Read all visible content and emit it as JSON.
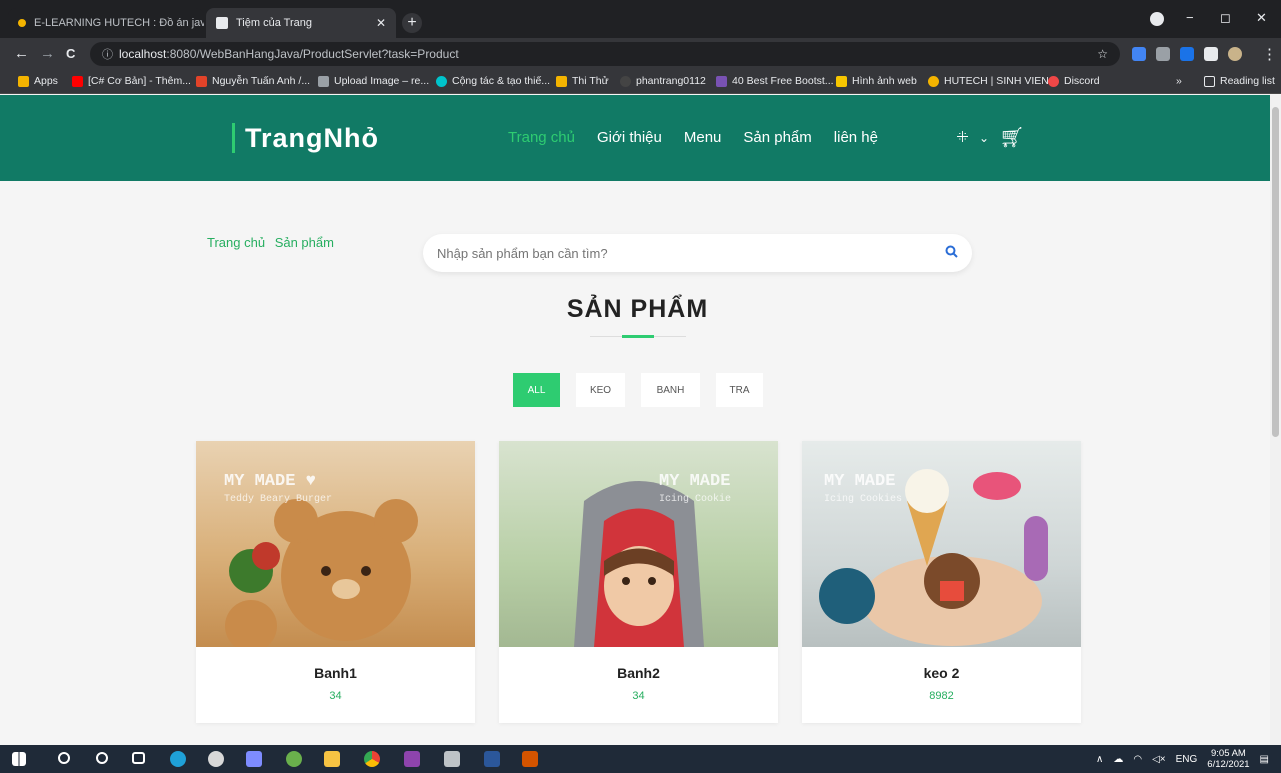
{
  "browser": {
    "tabs": [
      {
        "title": "E-LEARNING HUTECH : Đồ án jav",
        "active": false
      },
      {
        "title": "Tiệm của Trang",
        "active": true
      }
    ],
    "url_host": "localhost",
    "url_rest": ":8080/WebBanHangJava/ProductServlet?task=Product",
    "bookmarks": [
      {
        "label": "Apps",
        "color": "#f4b400"
      },
      {
        "label": "[C# Cơ Bản] - Thêm...",
        "color": "#ff0000"
      },
      {
        "label": "Nguyễn Tuấn Anh /...",
        "color": "#e24329"
      },
      {
        "label": "Upload Image – re...",
        "color": "#9aa0a6"
      },
      {
        "label": "Cộng tác & tạo thiế...",
        "color": "#00c4cc"
      },
      {
        "label": "Thi Thử",
        "color": "#f4b400"
      },
      {
        "label": "phantrang0112",
        "color": "#444"
      },
      {
        "label": "40 Best Free Bootst...",
        "color": "#7952b3"
      },
      {
        "label": "Hình ảnh web",
        "color": "#f7c600"
      },
      {
        "label": "HUTECH | SINH VIEN",
        "color": "#f4b400"
      },
      {
        "label": "Discord",
        "color": "#f04747"
      }
    ],
    "reading_list": "Reading list",
    "more_bookmarks": "»"
  },
  "site": {
    "logo": "TrangNhỏ",
    "menu": [
      "Trang chủ",
      "Giới thiệu",
      "Menu",
      "Sản phẩm",
      "liên hệ"
    ],
    "current_menu": "Trang chủ"
  },
  "breadcrumb": [
    "Trang chủ",
    "Sản phẩm"
  ],
  "search": {
    "placeholder": "Nhập sản phẩm bạn cần tìm?"
  },
  "section_title": "SẢN PHẨM",
  "filters": [
    {
      "label": "ALL",
      "active": true
    },
    {
      "label": "KEO",
      "active": false
    },
    {
      "label": "BANH",
      "active": false
    },
    {
      "label": "TRA",
      "active": false
    }
  ],
  "products": [
    {
      "name": "Banh1",
      "price": "34",
      "caption": "MY MADE ♥",
      "sub": "Teddy Beary Burger",
      "bg": "#d9b07a"
    },
    {
      "name": "Banh2",
      "price": "34",
      "caption": "MY MADE",
      "sub": "Icing Cookie",
      "bg": "#b8cfa6"
    },
    {
      "name": "keo 2",
      "price": "8982",
      "caption": "MY MADE",
      "sub": "Icing Cookies",
      "bg": "#cfd6d6"
    }
  ],
  "taskbar": {
    "lang": "ENG",
    "time": "9:05 AM",
    "date": "6/12/2021"
  }
}
